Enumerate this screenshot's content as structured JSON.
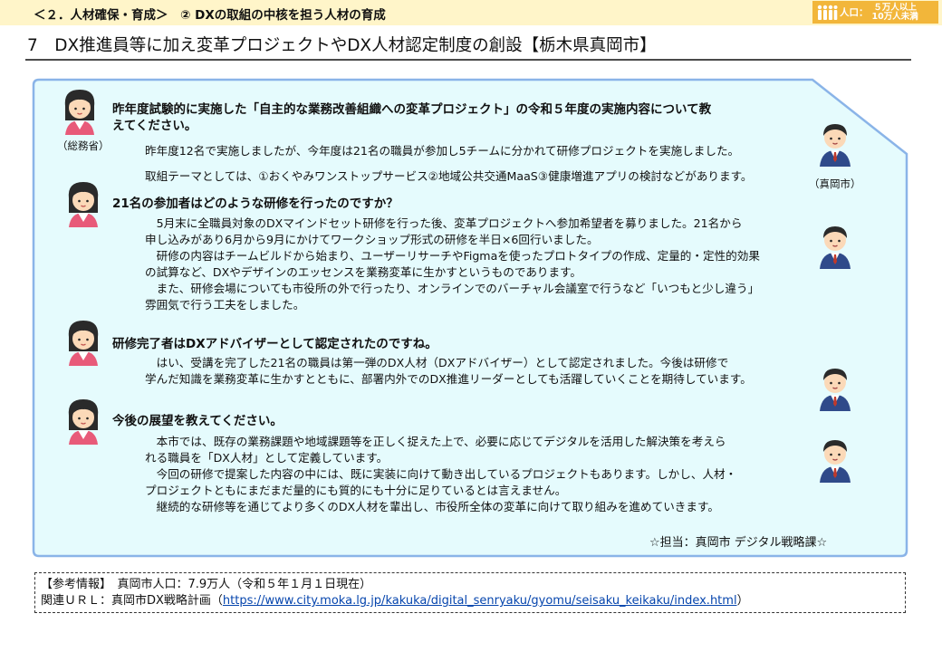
{
  "header": {
    "section": "＜２．人材確保・育成＞　② DXの取組の中核を担う人材の育成",
    "population_badge": {
      "label": "人口：",
      "value_line1": "５万人以上",
      "value_line2": "10万人未満",
      "icon": "people-icon"
    }
  },
  "title": "7　DX推進員等に加え変革プロジェクトやDX人材認定制度の創設【栃木県真岡市】",
  "speakers": {
    "ministry_caption": "（総務省）",
    "city_caption": "（真岡市）"
  },
  "qa": [
    {
      "question_lines": [
        "昨年度試験的に実施した「自主的な業務改善組織への変革プロジェクト」の令和５年度の実施内容について教",
        "えてください。"
      ],
      "answer_lines": [
        "昨年度12名で実施しましたが、今年度は21名の職員が参加し5チームに分かれて研修プロジェクトを実施しました。",
        "取組テーマとしては、①おくやみワンストップサービス②地域公共交通MaaS③健康増進アプリの検討などがあります。"
      ]
    },
    {
      "question_lines": [
        "21名の参加者はどのような研修を行ったのですか？"
      ],
      "answer_lines": [
        "　5月末に全職員対象のDXマインドセット研修を行った後、変革プロジェクトへ参加希望者を募りました。21名から",
        "申し込みがあり6月から9月にかけてワークショップ形式の研修を半日×6回行いました。",
        "　研修の内容はチームビルドから始まり、ユーザーリサーチやFigmaを使ったプロトタイプの作成、定量的・定性的効果",
        "の試算など、DXやデザインのエッセンスを業務変革に生かすというものであります。",
        "　また、研修会場についても市役所の外で行ったり、オンラインでのバーチャル会議室で行うなど「いつもと少し違う」",
        "雰囲気で行う工夫をしました。"
      ]
    },
    {
      "question_lines": [
        "研修完了者はDXアドバイザーとして認定されたのですね。"
      ],
      "answer_lines": [
        "　はい、受講を完了した21名の職員は第一弾のDX人材（DXアドバイザー）として認定されました。今後は研修で",
        "学んだ知識を業務変革に生かすとともに、部署内外でのDX推進リーダーとしても活躍していくことを期待しています。"
      ]
    },
    {
      "question_lines": [
        "今後の展望を教えてください。"
      ],
      "answer_lines": [
        "　本市では、既存の業務課題や地域課題等を正しく捉えた上で、必要に応じてデジタルを活用した解決策を考えら",
        "れる職員を「DX人材」として定義しています。",
        "　今回の研修で提案した内容の中には、既に実装に向けて動き出しているプロジェクトもあります。しかし、人材・",
        "プロジェクトともにまだまだ量的にも質的にも十分に足りているとは言えません。",
        "　継続的な研修等を通じてより多くのDX人材を輩出し、市役所全体の変革に向けて取り組みを進めていきます。"
      ]
    }
  ],
  "contact": "☆担当：真岡市 デジタル戦略課☆",
  "reference": {
    "line1": "【参考情報】　真岡市人口：7.9万人（令和５年１月１日現在）",
    "related_prefix": "関連ＵＲＬ：真岡市DX戦略計画（",
    "related_url": "https://www.city.moka.lg.jp/kakuka/digital_senryaku/gyomu/seisaku_keikaku/index.html",
    "related_suffix": "）"
  },
  "colors": {
    "panel_fill": "#e5fbfd",
    "panel_border": "#8ab4e8",
    "header_bg": "#fff5c9",
    "badge": "#f2b63a"
  }
}
